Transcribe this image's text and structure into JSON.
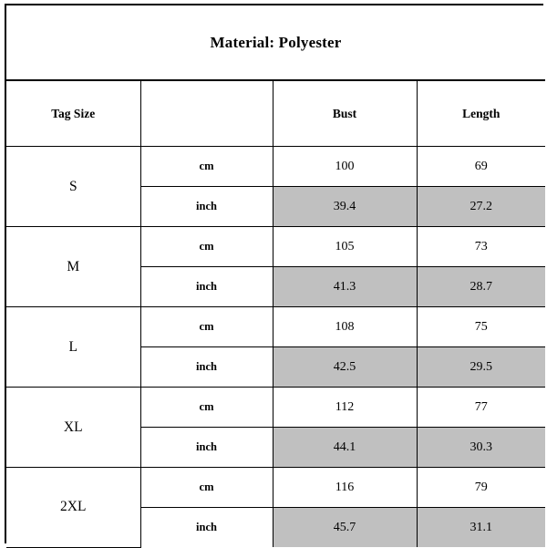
{
  "banner": {
    "text": "Material: Polyester"
  },
  "table": {
    "headers": {
      "tag_size": "Tag Size",
      "unit": "",
      "bust": "Bust",
      "length": "Length"
    },
    "units": {
      "metric": "cm",
      "imperial": "inch"
    },
    "colors": {
      "highlight": "#c0c0c0",
      "border": "#000000",
      "background": "#ffffff",
      "text": "#000000"
    },
    "rows": [
      {
        "tag_size": "S",
        "cm": {
          "unit": "cm",
          "bust": "100",
          "length": "69"
        },
        "inch": {
          "unit": "inch",
          "bust": "39.4",
          "length": "27.2"
        }
      },
      {
        "tag_size": "M",
        "cm": {
          "unit": "cm",
          "bust": "105",
          "length": "73"
        },
        "inch": {
          "unit": "inch",
          "bust": "41.3",
          "length": "28.7"
        }
      },
      {
        "tag_size": "L",
        "cm": {
          "unit": "cm",
          "bust": "108",
          "length": "75"
        },
        "inch": {
          "unit": "inch",
          "bust": "42.5",
          "length": "29.5"
        }
      },
      {
        "tag_size": "XL",
        "cm": {
          "unit": "cm",
          "bust": "112",
          "length": "77"
        },
        "inch": {
          "unit": "inch",
          "bust": "44.1",
          "length": "30.3"
        }
      },
      {
        "tag_size": "2XL",
        "cm": {
          "unit": "cm",
          "bust": "116",
          "length": "79"
        },
        "inch": {
          "unit": "inch",
          "bust": "45.7",
          "length": "31.1"
        }
      }
    ]
  }
}
